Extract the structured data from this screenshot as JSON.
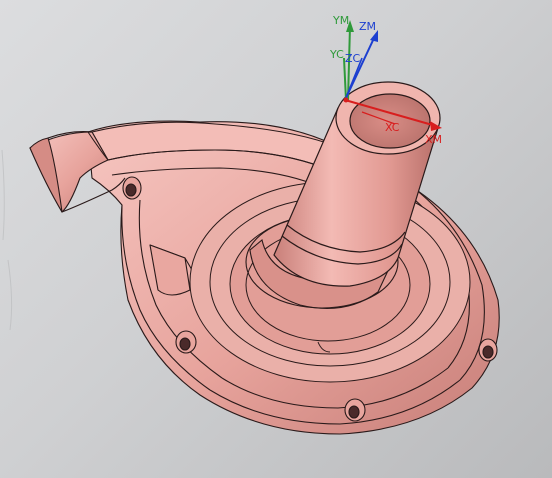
{
  "viewport": {
    "background_top": "#dcdddf",
    "background_bottom": "#b9babc"
  },
  "model": {
    "shade_color": "#ebaaa3",
    "edge_color": "#2a1a1a"
  },
  "triad": {
    "ym_label": "YM",
    "zm_label": "ZM",
    "yc_label": "YC",
    "zc_label": "ZC",
    "xc_label": "XC",
    "xm_label": "XM",
    "y_color": "#2f9a3a",
    "z_color": "#1c3fd0",
    "x_color": "#d81e1e"
  }
}
